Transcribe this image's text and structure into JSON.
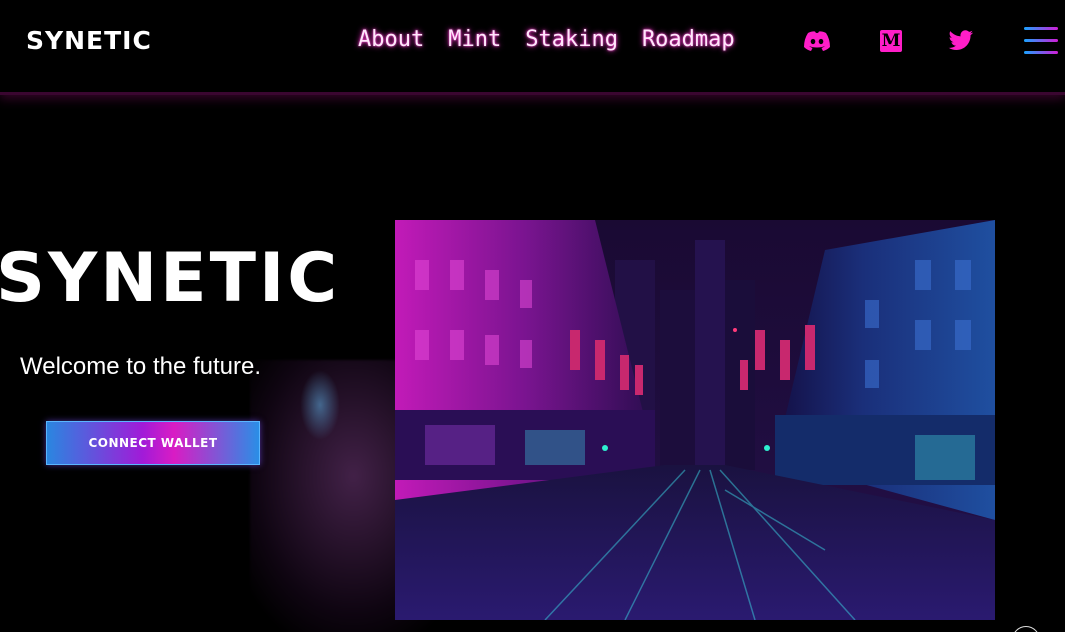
{
  "nav": {
    "brand": "SYNETIC",
    "links": [
      "About",
      "Mint",
      "Staking",
      "Roadmap"
    ],
    "social": [
      "discord-icon",
      "medium-icon",
      "twitter-icon"
    ],
    "medium_glyph": "M"
  },
  "hero": {
    "title": "SYNETIC",
    "tagline": "Welcome to the future.",
    "connect_label": "CONNECT WALLET"
  },
  "colors": {
    "accent_pink": "#ff1ec8",
    "accent_blue": "#2a86e0",
    "background": "#000000"
  }
}
